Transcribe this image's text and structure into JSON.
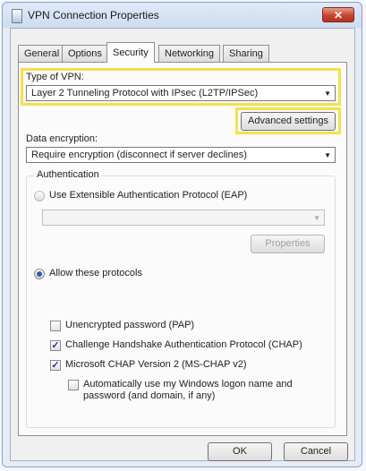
{
  "window": {
    "title": "VPN Connection Properties",
    "close_label": "✕"
  },
  "tabs": [
    {
      "label": "General"
    },
    {
      "label": "Options"
    },
    {
      "label": "Security"
    },
    {
      "label": "Networking"
    },
    {
      "label": "Sharing"
    }
  ],
  "security": {
    "vpn_type_label": "Type of VPN:",
    "vpn_type_value": "Layer 2 Tunneling Protocol with IPsec (L2TP/IPSec)",
    "advanced_settings_label": "Advanced settings",
    "data_encryption_label": "Data encryption:",
    "data_encryption_value": "Require encryption (disconnect if server declines)",
    "authentication": {
      "group_label": "Authentication",
      "eap_label": "Use Extensible Authentication Protocol (EAP)",
      "eap_combo_value": "",
      "properties_label": "Properties",
      "allow_protocols_label": "Allow these protocols",
      "protocols": [
        {
          "label": "Unencrypted password (PAP)",
          "checked": false
        },
        {
          "label": "Challenge Handshake Authentication Protocol (CHAP)",
          "checked": true
        },
        {
          "label": "Microsoft CHAP Version 2 (MS-CHAP v2)",
          "checked": true
        }
      ],
      "auto_logon_line1": "Automatically use my Windows logon name and",
      "auto_logon_line2": "password (and domain, if any)",
      "auto_logon_checked": false
    }
  },
  "buttons": {
    "ok_label": "OK",
    "cancel_label": "Cancel"
  },
  "colors": {
    "highlight": "#f5e14a",
    "radio_accent": "#2b5fa8"
  }
}
